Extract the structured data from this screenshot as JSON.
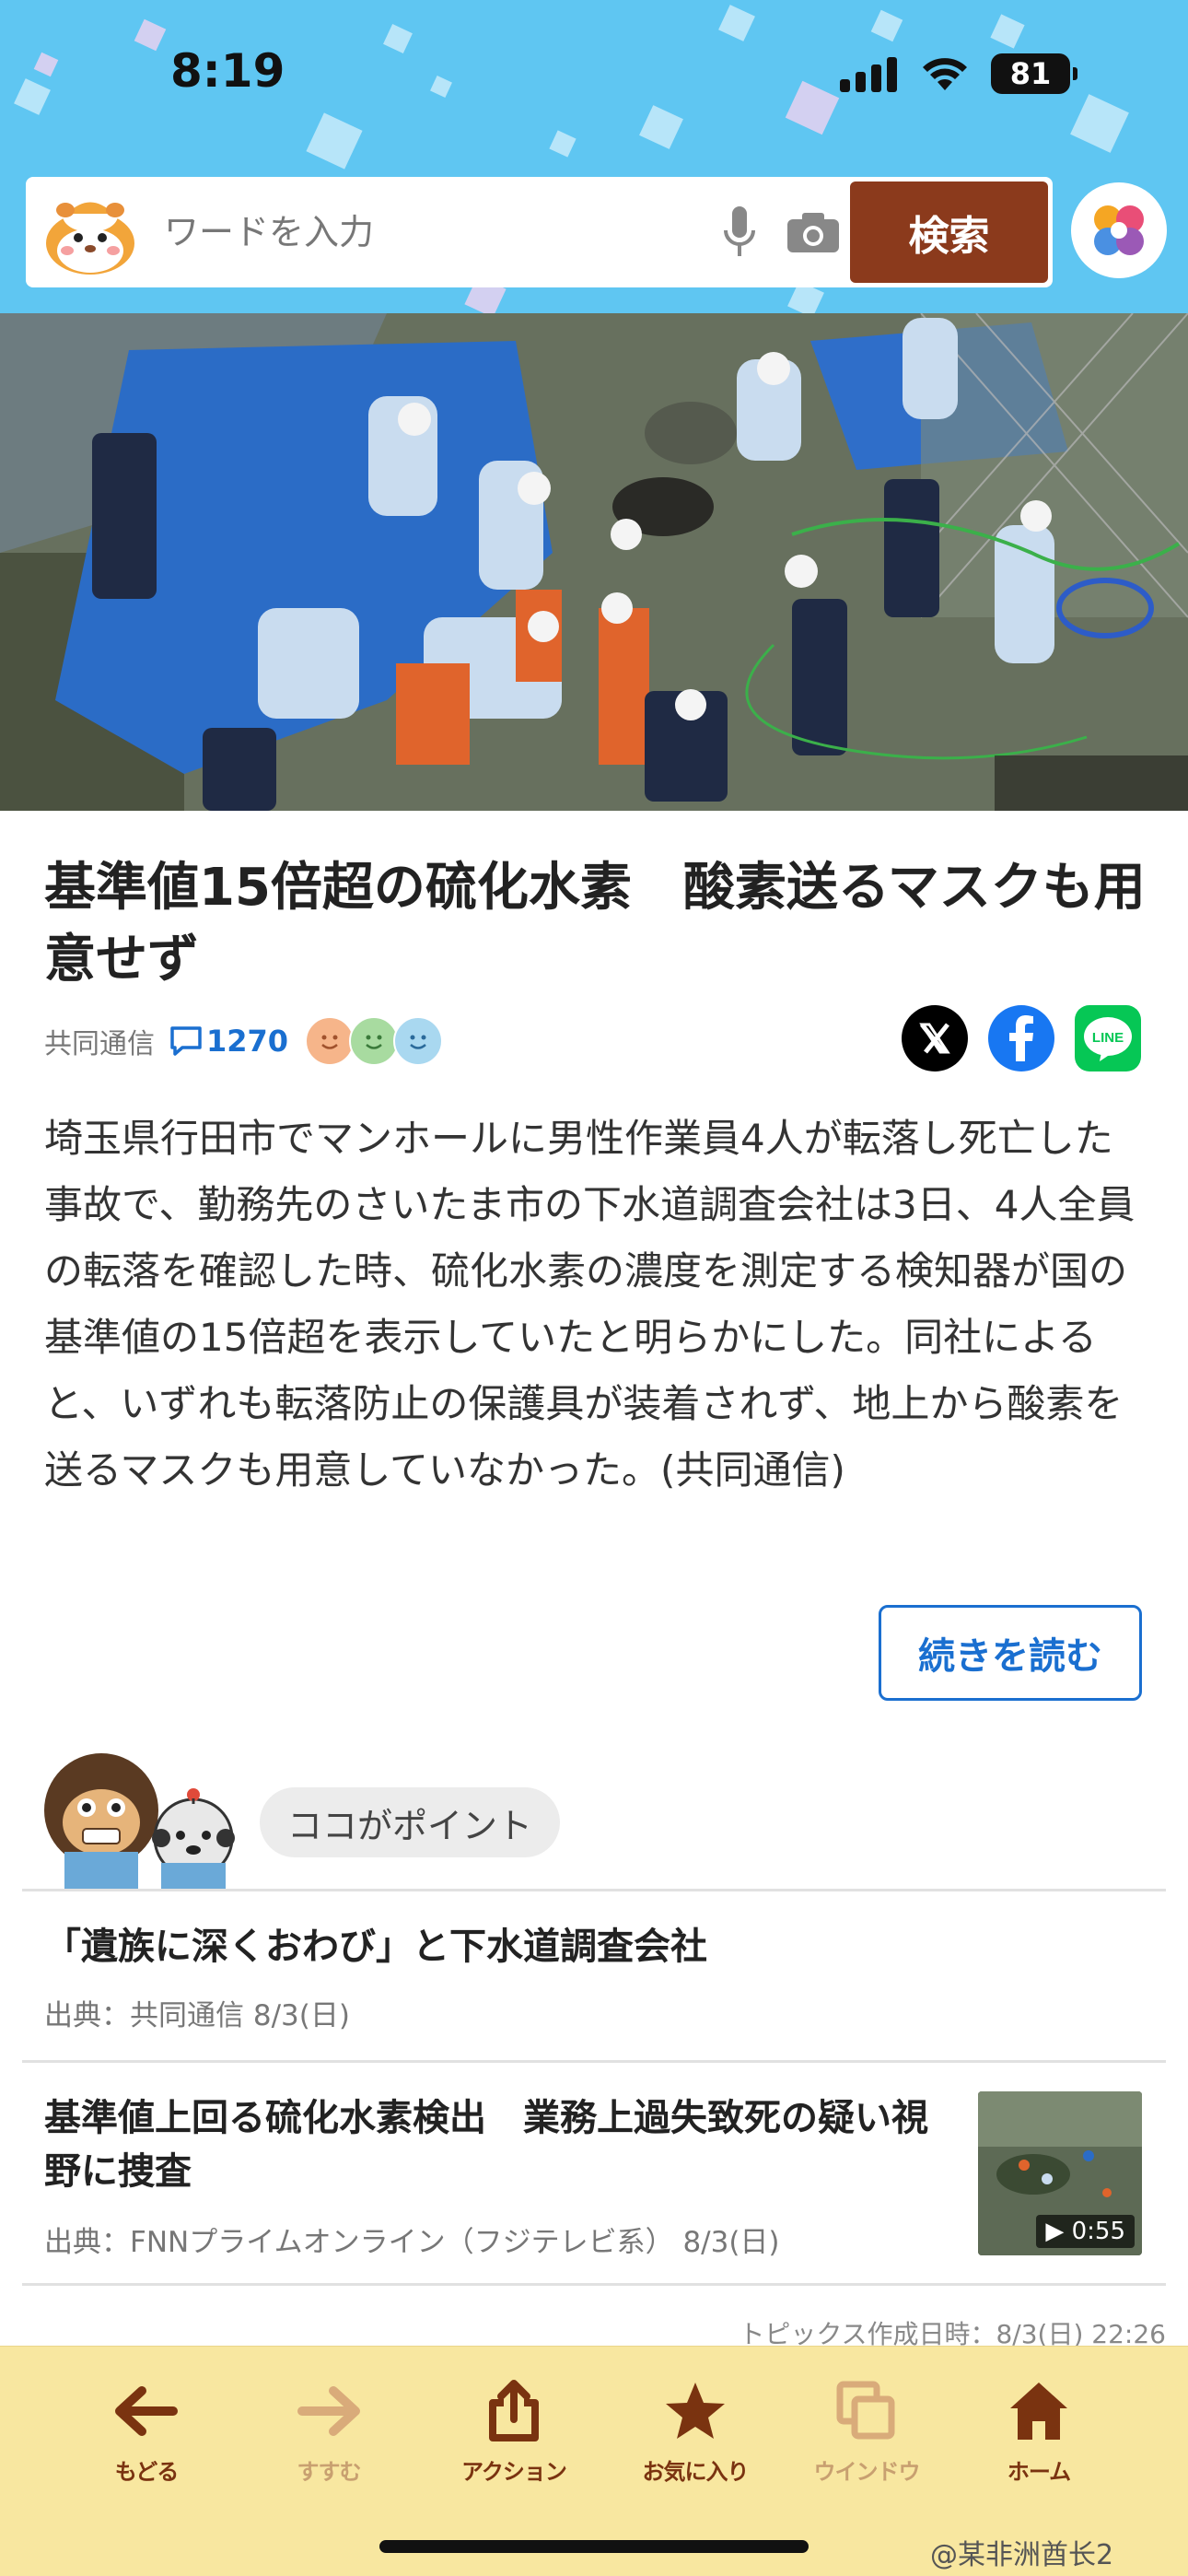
{
  "status_bar": {
    "time": "8:19",
    "battery": "81"
  },
  "search": {
    "placeholder": "ワードを入力",
    "button_label": "検索"
  },
  "article": {
    "title": "基準値15倍超の硫化水素　酸素送るマスクも用意せず",
    "source": "共同通信",
    "comment_count": "1270",
    "body": "埼玉県行田市でマンホールに男性作業員4人が転落し死亡した事故で、勤務先のさいたま市の下水道調査会社は3日、4人全員の転落を確認した時、硫化水素の濃度を測定する検知器が国の基準値の15倍超を表示していたと明らかにした。同社によると、いずれも転落防止の保護具が装着されず、地上から酸素を送るマスクも用意していなかった。(共同通信)",
    "read_more_label": "続きを読む",
    "share": [
      "x-icon",
      "facebook-icon",
      "line-icon"
    ],
    "line_label": "LINE"
  },
  "point": {
    "label": "ココがポイント"
  },
  "related": [
    {
      "title": "「遺族に深くおわび」と下水道調査会社",
      "source": "出典：共同通信  8/3(日)"
    },
    {
      "title": "基準値上回る硫化水素検出　業務上過失致死の疑い視野に捜査",
      "source": "出典：FNNプライムオンライン（フジテレビ系）  8/3(日)",
      "video_duration": "▶ 0:55"
    }
  ],
  "topics_date": "トピックス作成日時：8/3(日) 22:26",
  "toolbar": {
    "back": "もどる",
    "forward": "すすむ",
    "action": "アクション",
    "favorite": "お気に入り",
    "window": "ウインドウ",
    "home": "ホーム"
  },
  "watermark": "@某非洲酋长2",
  "colors": {
    "header_bg": "#5fc6f2",
    "search_button": "#8b3a1c",
    "link_blue": "#1a6fd0",
    "toolbar_bg": "#f8e7a0",
    "toolbar_text": "#7a3310"
  }
}
